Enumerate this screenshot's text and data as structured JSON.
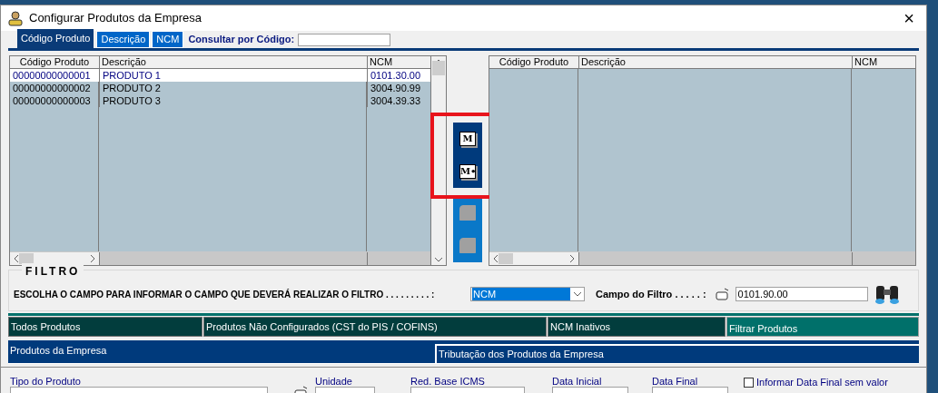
{
  "window": {
    "title": "Configurar Produtos da Empresa",
    "close": "×"
  },
  "search_tabs": [
    {
      "label": "Código Produto",
      "selected": true
    },
    {
      "label": "Descrição",
      "selected": false
    },
    {
      "label": "NCM",
      "selected": false
    }
  ],
  "consult": {
    "label": "Consultar por Código:"
  },
  "left_grid": {
    "columns": [
      "Código Produto",
      "Descrição",
      "NCM"
    ],
    "rows": [
      {
        "cells": [
          "00000000000001",
          "PRODUTO 1",
          "0101.30.00"
        ],
        "selected": true
      },
      {
        "cells": [
          "00000000000002",
          "PRODUTO 2",
          "3004.90.99"
        ],
        "selected": false
      },
      {
        "cells": [
          "00000000000003",
          "PRODUTO 3",
          "3004.39.33"
        ],
        "selected": false
      }
    ]
  },
  "move_buttons": [
    {
      "glyph": "M",
      "enabled": true
    },
    {
      "glyph": "M•",
      "enabled": true
    },
    {
      "enabled": false
    },
    {
      "enabled": false
    }
  ],
  "right_grid": {
    "columns": [
      "Código Produto",
      "Descrição",
      "NCM"
    ]
  },
  "filter": {
    "title": "FILTRO",
    "prompt": "ESCOLHA O CAMPO PARA INFORMAR O CAMPO QUE DEVERÁ REALIZAR O FILTRO . . . . . . . . . :",
    "field_select": "NCM",
    "value_label": "Campo do Filtro . . . . . :",
    "value": "0101.90.00"
  },
  "filter_buttons": [
    {
      "label": "Todos Produtos",
      "selected": false
    },
    {
      "label": "Produtos Não Configurados (CST do PIS / COFINS)",
      "selected": false
    },
    {
      "label": "NCM Inativos",
      "selected": false
    },
    {
      "label": "Filtrar Produtos",
      "selected": true
    }
  ],
  "bottom_tabs": [
    {
      "label": "Produtos da Empresa",
      "selected": true
    },
    {
      "label": "Tributação dos Produtos da Empresa",
      "selected": false
    }
  ],
  "form": {
    "tipo": "Tipo do Produto",
    "unidade": "Unidade",
    "red_base": "Red. Base ICMS",
    "data_inicial": "Data Inicial",
    "data_final": "Data Final",
    "informar": "Informar Data Final sem valor",
    "informar_checked": false
  }
}
